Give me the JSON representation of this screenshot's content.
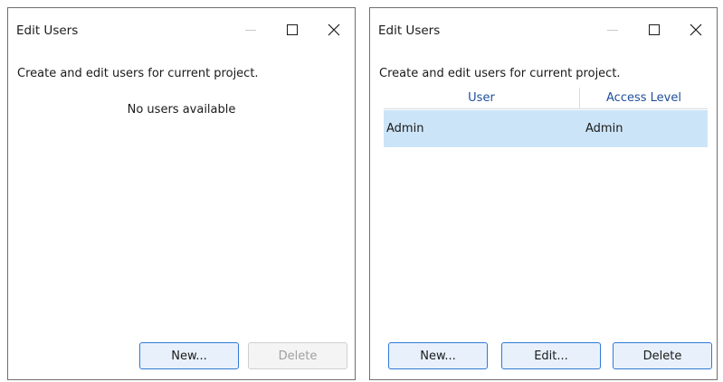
{
  "left_dialog": {
    "title": "Edit Users",
    "description": "Create and edit users for current project.",
    "empty_message": "No users available",
    "buttons": {
      "new": "New...",
      "delete": "Delete"
    }
  },
  "right_dialog": {
    "title": "Edit Users",
    "description": "Create and edit users for current project.",
    "columns": {
      "user": "User",
      "access_level": "Access Level"
    },
    "rows": [
      {
        "user": "Admin",
        "access_level": "Admin"
      }
    ],
    "buttons": {
      "new": "New...",
      "edit": "Edit...",
      "delete": "Delete"
    }
  },
  "icons": {
    "minimize": "minimize-icon",
    "maximize": "maximize-icon",
    "close": "close-icon"
  },
  "colors": {
    "selection": "#cce4f7",
    "header_text": "#1f4e9a",
    "button_border": "#2f7ad6"
  }
}
